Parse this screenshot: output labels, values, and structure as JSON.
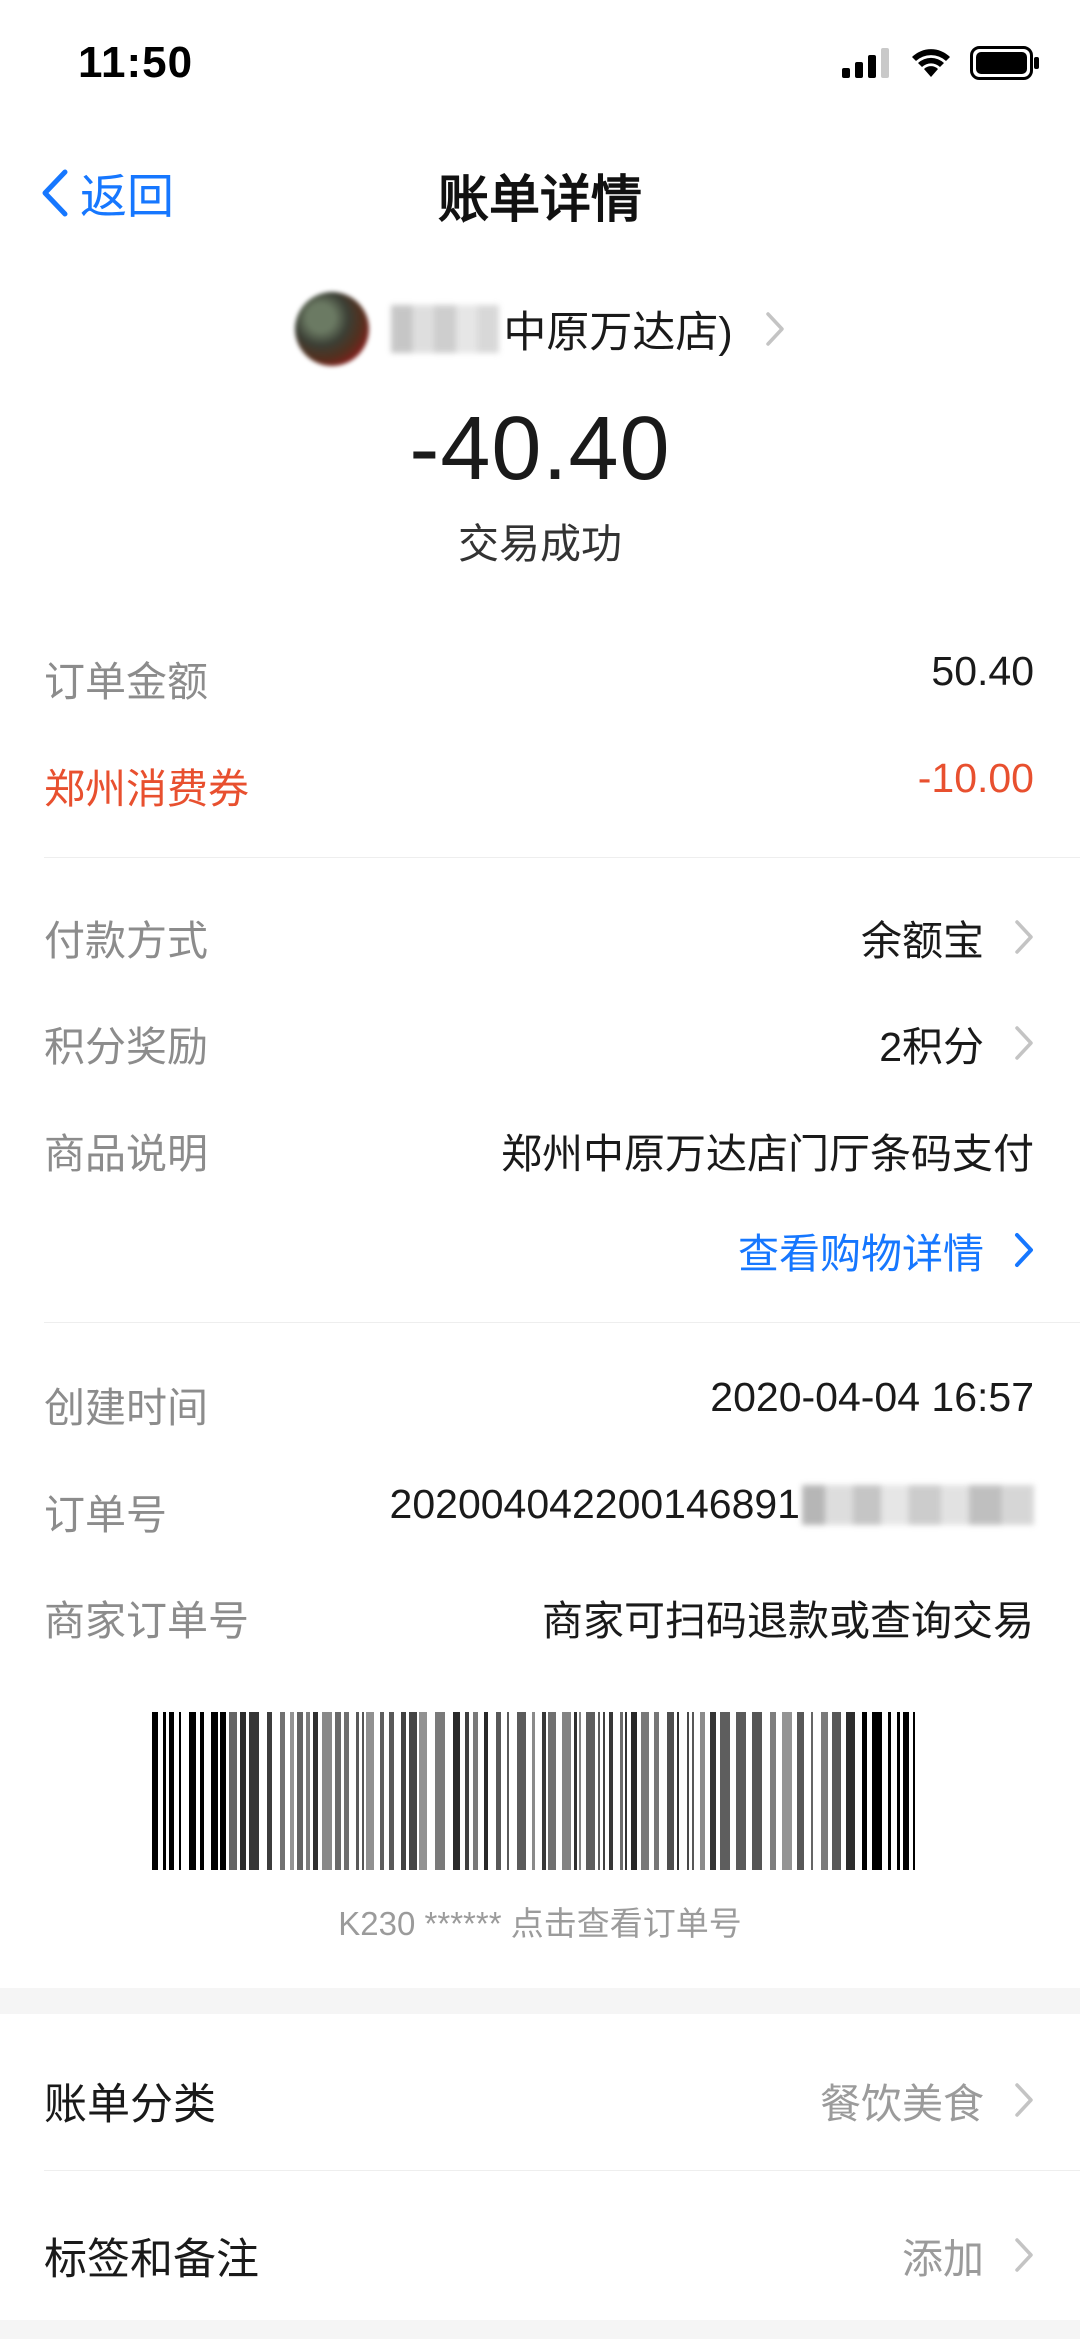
{
  "status_bar": {
    "time": "11:50"
  },
  "nav": {
    "back_label": "返回",
    "title": "账单详情"
  },
  "merchant": {
    "name_visible": "中原万达店)",
    "amount": "-40.40",
    "status": "交易成功"
  },
  "amounts": [
    {
      "label": "订单金额",
      "value": "50.40"
    },
    {
      "label": "郑州消费券",
      "value": "-10.00"
    }
  ],
  "details": {
    "payment_method": {
      "label": "付款方式",
      "value": "余额宝"
    },
    "points": {
      "label": "积分奖励",
      "value": "2积分"
    },
    "product": {
      "label": "商品说明",
      "value": "郑州中原万达店门厅条码支付"
    },
    "shopping_link": "查看购物详情"
  },
  "info": {
    "created": {
      "label": "创建时间",
      "value": "2020-04-04 16:57"
    },
    "order_no": {
      "label": "订单号",
      "value": "202004042200146891"
    },
    "merchant_order": {
      "label": "商家订单号",
      "value": "商家可扫码退款或查询交易"
    }
  },
  "barcode": {
    "caption": "K230 ****** 点击查看订单号"
  },
  "bottom": {
    "category": {
      "label": "账单分类",
      "value": "餐饮美食"
    },
    "tags": {
      "label": "标签和备注",
      "value": "添加"
    }
  },
  "colors": {
    "accent": "#1677ff",
    "red": "#e8502f",
    "gray_text": "#8c8c8c"
  }
}
